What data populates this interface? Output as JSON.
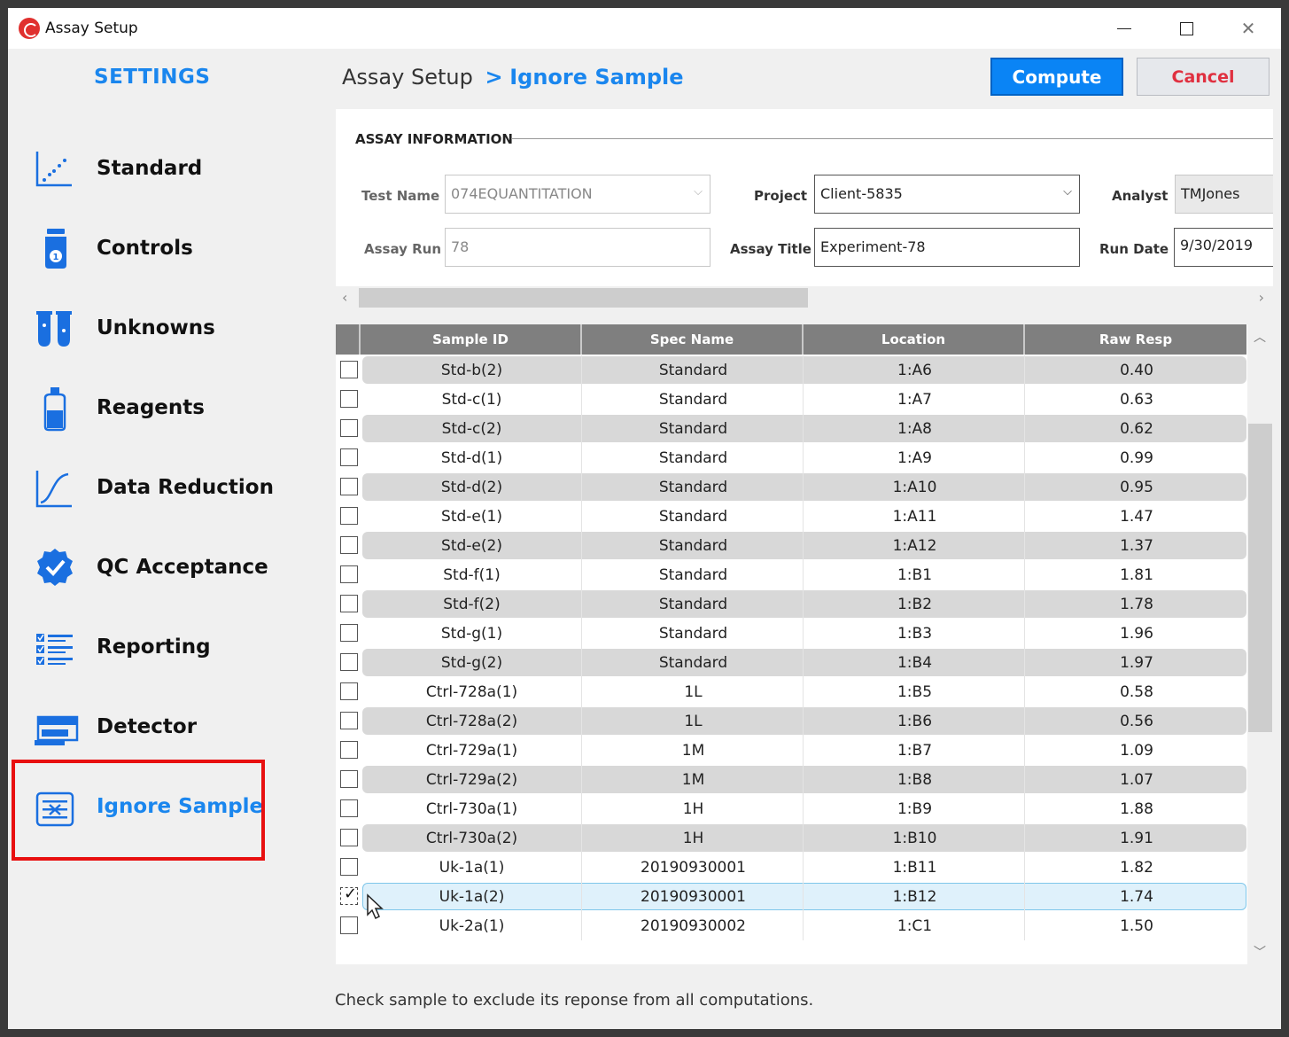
{
  "window": {
    "title": "Assay Setup"
  },
  "sidebar": {
    "heading": "SETTINGS",
    "items": [
      {
        "label": "Standard",
        "icon": "scatter-chart-icon"
      },
      {
        "label": "Controls",
        "icon": "vial-icon"
      },
      {
        "label": "Unknowns",
        "icon": "test-tubes-icon"
      },
      {
        "label": "Reagents",
        "icon": "bottle-icon"
      },
      {
        "label": "Data Reduction",
        "icon": "curve-chart-icon"
      },
      {
        "label": "QC Acceptance",
        "icon": "badge-check-icon"
      },
      {
        "label": "Reporting",
        "icon": "checklist-icon"
      },
      {
        "label": "Detector",
        "icon": "plate-reader-icon"
      },
      {
        "label": "Ignore Sample",
        "icon": "ignore-sample-icon",
        "active": true
      }
    ]
  },
  "header": {
    "breadcrumb_root": "Assay Setup",
    "breadcrumb_sep": ">",
    "breadcrumb_current": "Ignore Sample",
    "compute_label": "Compute",
    "cancel_label": "Cancel"
  },
  "assay_info": {
    "section_title": "ASSAY INFORMATION",
    "test_name_label": "Test Name",
    "test_name_value": "074EQUANTITATION",
    "project_label": "Project",
    "project_value": "Client-5835",
    "analyst_label": "Analyst",
    "analyst_value": "TMJones",
    "assay_run_label": "Assay Run",
    "assay_run_value": "78",
    "assay_title_label": "Assay Title",
    "assay_title_value": "Experiment-78",
    "run_date_label": "Run Date",
    "run_date_value": "9/30/2019"
  },
  "grid": {
    "columns": [
      "Sample ID",
      "Spec Name",
      "Location",
      "Raw Resp"
    ],
    "rows": [
      {
        "sample_id": "Std-b(2)",
        "spec": "Standard",
        "location": "1:A6",
        "raw": "0.40",
        "checked": false
      },
      {
        "sample_id": "Std-c(1)",
        "spec": "Standard",
        "location": "1:A7",
        "raw": "0.63",
        "checked": false
      },
      {
        "sample_id": "Std-c(2)",
        "spec": "Standard",
        "location": "1:A8",
        "raw": "0.62",
        "checked": false
      },
      {
        "sample_id": "Std-d(1)",
        "spec": "Standard",
        "location": "1:A9",
        "raw": "0.99",
        "checked": false
      },
      {
        "sample_id": "Std-d(2)",
        "spec": "Standard",
        "location": "1:A10",
        "raw": "0.95",
        "checked": false
      },
      {
        "sample_id": "Std-e(1)",
        "spec": "Standard",
        "location": "1:A11",
        "raw": "1.47",
        "checked": false
      },
      {
        "sample_id": "Std-e(2)",
        "spec": "Standard",
        "location": "1:A12",
        "raw": "1.37",
        "checked": false
      },
      {
        "sample_id": "Std-f(1)",
        "spec": "Standard",
        "location": "1:B1",
        "raw": "1.81",
        "checked": false
      },
      {
        "sample_id": "Std-f(2)",
        "spec": "Standard",
        "location": "1:B2",
        "raw": "1.78",
        "checked": false
      },
      {
        "sample_id": "Std-g(1)",
        "spec": "Standard",
        "location": "1:B3",
        "raw": "1.96",
        "checked": false
      },
      {
        "sample_id": "Std-g(2)",
        "spec": "Standard",
        "location": "1:B4",
        "raw": "1.97",
        "checked": false
      },
      {
        "sample_id": "Ctrl-728a(1)",
        "spec": "1L",
        "location": "1:B5",
        "raw": "0.58",
        "checked": false
      },
      {
        "sample_id": "Ctrl-728a(2)",
        "spec": "1L",
        "location": "1:B6",
        "raw": "0.56",
        "checked": false
      },
      {
        "sample_id": "Ctrl-729a(1)",
        "spec": "1M",
        "location": "1:B7",
        "raw": "1.09",
        "checked": false
      },
      {
        "sample_id": "Ctrl-729a(2)",
        "spec": "1M",
        "location": "1:B8",
        "raw": "1.07",
        "checked": false
      },
      {
        "sample_id": "Ctrl-730a(1)",
        "spec": "1H",
        "location": "1:B9",
        "raw": "1.88",
        "checked": false
      },
      {
        "sample_id": "Ctrl-730a(2)",
        "spec": "1H",
        "location": "1:B10",
        "raw": "1.91",
        "checked": false
      },
      {
        "sample_id": "Uk-1a(1)",
        "spec": "20190930001",
        "location": "1:B11",
        "raw": "1.82",
        "checked": false
      },
      {
        "sample_id": "Uk-1a(2)",
        "spec": "20190930001",
        "location": "1:B12",
        "raw": "1.74",
        "checked": true,
        "selected": true
      },
      {
        "sample_id": "Uk-2a(1)",
        "spec": "20190930002",
        "location": "1:C1",
        "raw": "1.50",
        "checked": false
      }
    ]
  },
  "footer": {
    "hint": "Check sample to exclude its reponse from all computations."
  },
  "colors": {
    "accent": "#1a86ee",
    "compute_bg": "#0a84f5",
    "cancel_text": "#e03040",
    "highlight_box": "#e81010"
  }
}
